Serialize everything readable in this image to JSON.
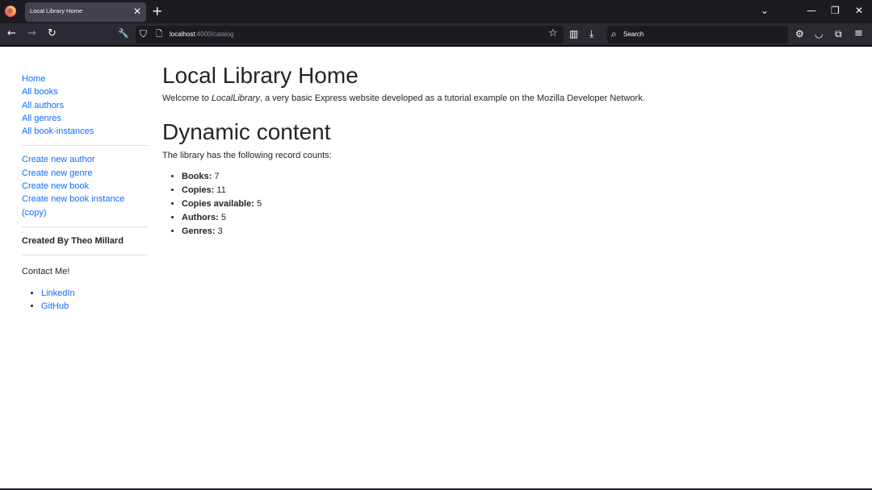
{
  "browser": {
    "tab_title": "Local Library Home",
    "tab_close": "✕",
    "new_tab": "+",
    "url_host": "localhost",
    "url_path": ":4000/catalog",
    "search_placeholder": "Search",
    "icons": {
      "back": "←",
      "forward": "→",
      "reload": "↻",
      "tools": "🔧",
      "shield": "⛉",
      "page": "🗋",
      "bookmark": "☆",
      "reader": "▥",
      "download": "⤓",
      "search": "⌕",
      "settings": "⚙",
      "pocket": "◡",
      "extensions": "⧉",
      "menu": "≡",
      "list_tabs": "⌄",
      "minimize": "—",
      "restore": "❐",
      "close": "✕"
    }
  },
  "sidebar": {
    "nav_links": [
      "Home",
      "All books",
      "All authors",
      "All genres",
      "All book-instances"
    ],
    "create_links": [
      "Create new author",
      "Create new genre",
      "Create new book",
      "Create new book instance",
      "(copy)"
    ],
    "creator": "Created By Theo Millard",
    "contact_label": "Contact Me!",
    "social_links": [
      "LinkedIn",
      "GitHub"
    ]
  },
  "main": {
    "title": "Local Library Home",
    "intro_before": "Welcome to ",
    "intro_em": "LocalLibrary",
    "intro_after": ", a very basic Express website developed as a tutorial example on the Mozilla Developer Network.",
    "section_title": "Dynamic content",
    "counts_intro": "The library has the following record counts:",
    "counts": [
      {
        "label": "Books:",
        "value": "7"
      },
      {
        "label": "Copies:",
        "value": "11"
      },
      {
        "label": "Copies available:",
        "value": "5"
      },
      {
        "label": "Authors:",
        "value": "5"
      },
      {
        "label": "Genres:",
        "value": "3"
      }
    ]
  }
}
